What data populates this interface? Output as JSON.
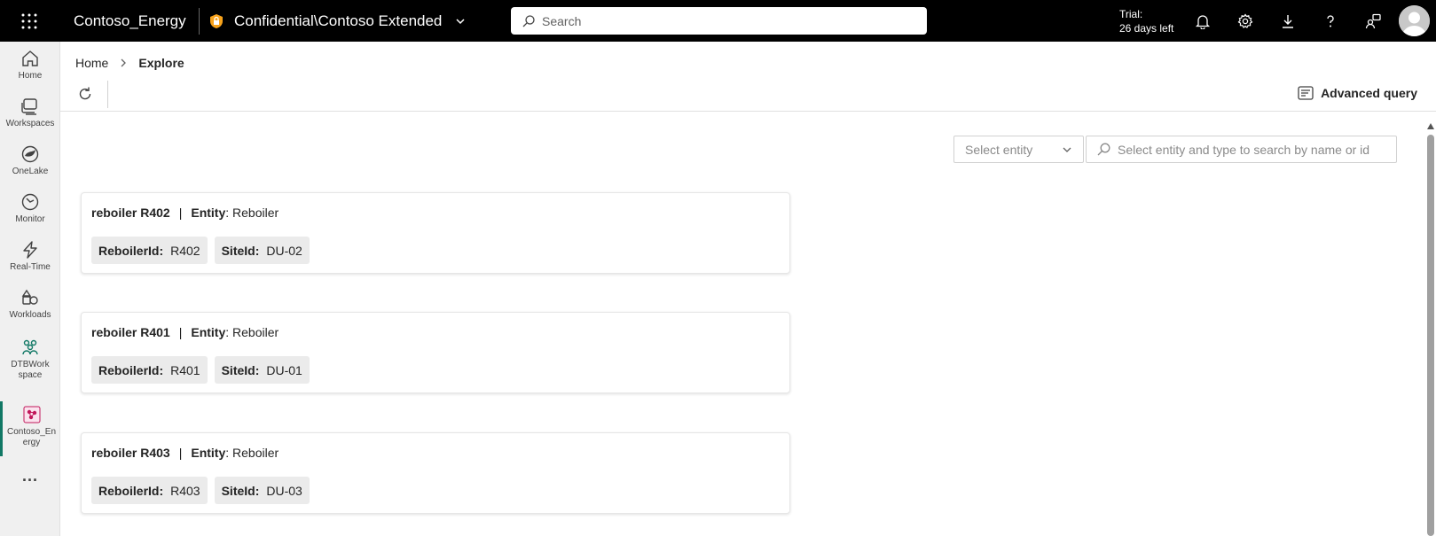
{
  "topbar": {
    "app_name": "Contoso_Energy",
    "sensitivity_label": "Confidential\\Contoso Extended",
    "search_placeholder": "Search",
    "trial_line1": "Trial:",
    "trial_line2": "26 days left"
  },
  "rail": {
    "items": [
      {
        "label": "Home",
        "icon": "home-icon"
      },
      {
        "label": "Workspaces",
        "icon": "workspaces-icon"
      },
      {
        "label": "OneLake",
        "icon": "onelake-icon"
      },
      {
        "label": "Monitor",
        "icon": "monitor-icon"
      },
      {
        "label": "Real-Time",
        "icon": "lightning-icon"
      },
      {
        "label": "Workloads",
        "icon": "workloads-icon"
      },
      {
        "label": "DTBWork space",
        "icon": "dtb-workspace-icon"
      },
      {
        "label": "Contoso_En ergy",
        "icon": "contoso-item-icon"
      }
    ],
    "more_label": "..."
  },
  "breadcrumb": {
    "home": "Home",
    "current": "Explore"
  },
  "toolbar": {
    "advanced_query": "Advanced query"
  },
  "filters": {
    "entity_select_placeholder": "Select entity",
    "entity_search_placeholder": "Select entity and type to search by name or id"
  },
  "results": [
    {
      "name": "reboiler R402",
      "entity_key": "Entity",
      "entity_value": ": Reboiler",
      "chips": [
        {
          "key": "ReboilerId:",
          "value": "R402"
        },
        {
          "key": "SiteId:",
          "value": "DU-02"
        }
      ]
    },
    {
      "name": "reboiler R401",
      "entity_key": "Entity",
      "entity_value": ": Reboiler",
      "chips": [
        {
          "key": "ReboilerId:",
          "value": "R401"
        },
        {
          "key": "SiteId:",
          "value": "DU-01"
        }
      ]
    },
    {
      "name": "reboiler R403",
      "entity_key": "Entity",
      "entity_value": ": Reboiler",
      "chips": [
        {
          "key": "ReboilerId:",
          "value": "R403"
        },
        {
          "key": "SiteId:",
          "value": "DU-03"
        }
      ]
    }
  ],
  "colors": {
    "accent": "#117865",
    "topbar_bg": "#000000"
  }
}
